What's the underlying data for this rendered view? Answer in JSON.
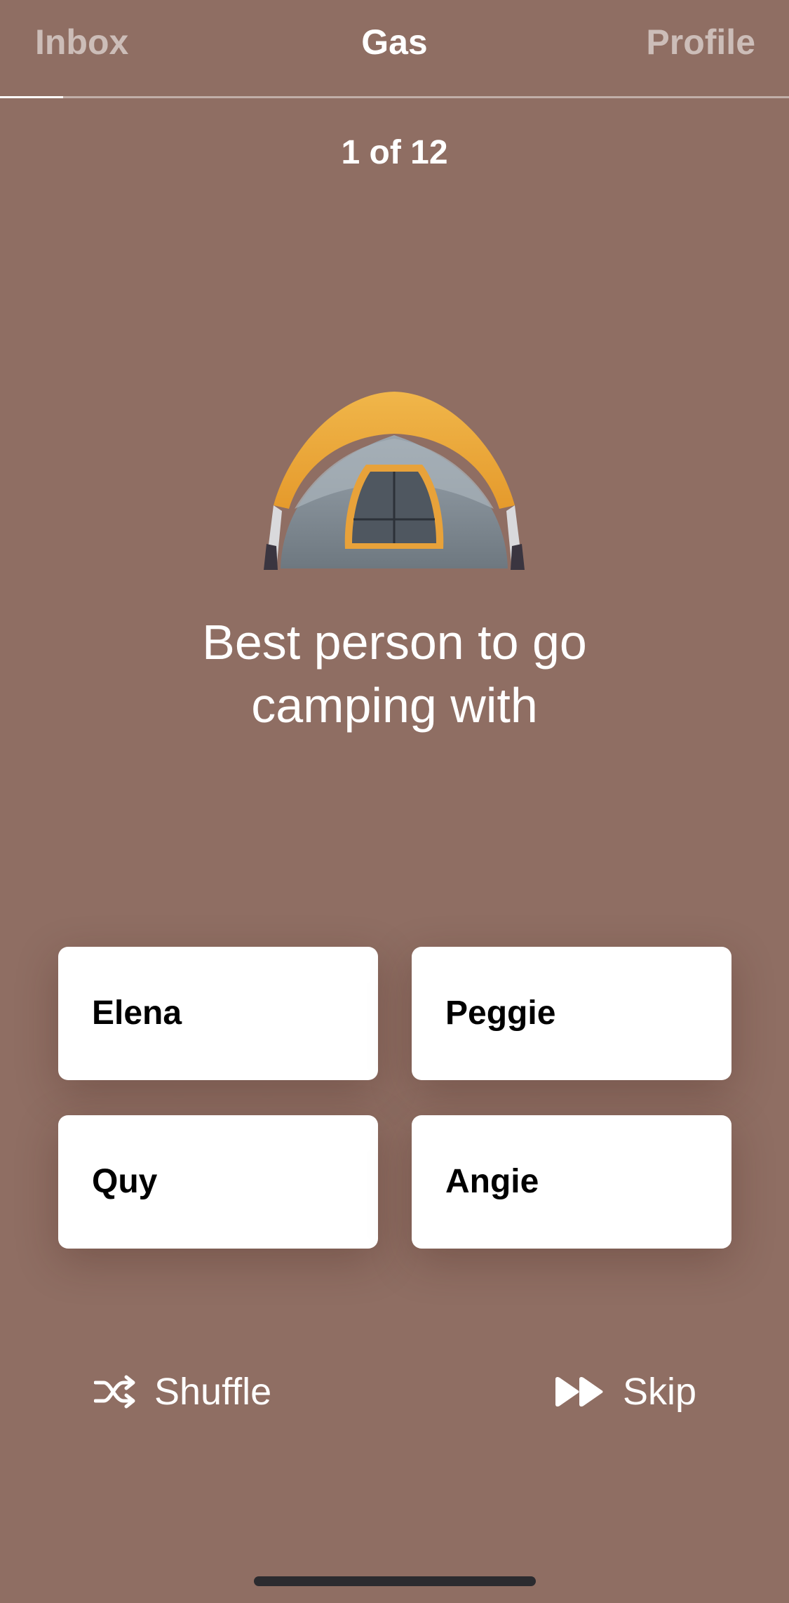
{
  "nav": {
    "inbox_label": "Inbox",
    "title": "Gas",
    "profile_label": "Profile",
    "progress": 0.08
  },
  "poll": {
    "counter": "1 of 12",
    "emoji_icon": "tent-icon",
    "question": "Best person to go camping with"
  },
  "options": [
    "Elena",
    "Peggie",
    "Quy",
    "Angie"
  ],
  "actions": {
    "shuffle_label": "Shuffle",
    "skip_label": "Skip"
  },
  "colors": {
    "background": "#8f6e63",
    "card": "#ffffff"
  }
}
